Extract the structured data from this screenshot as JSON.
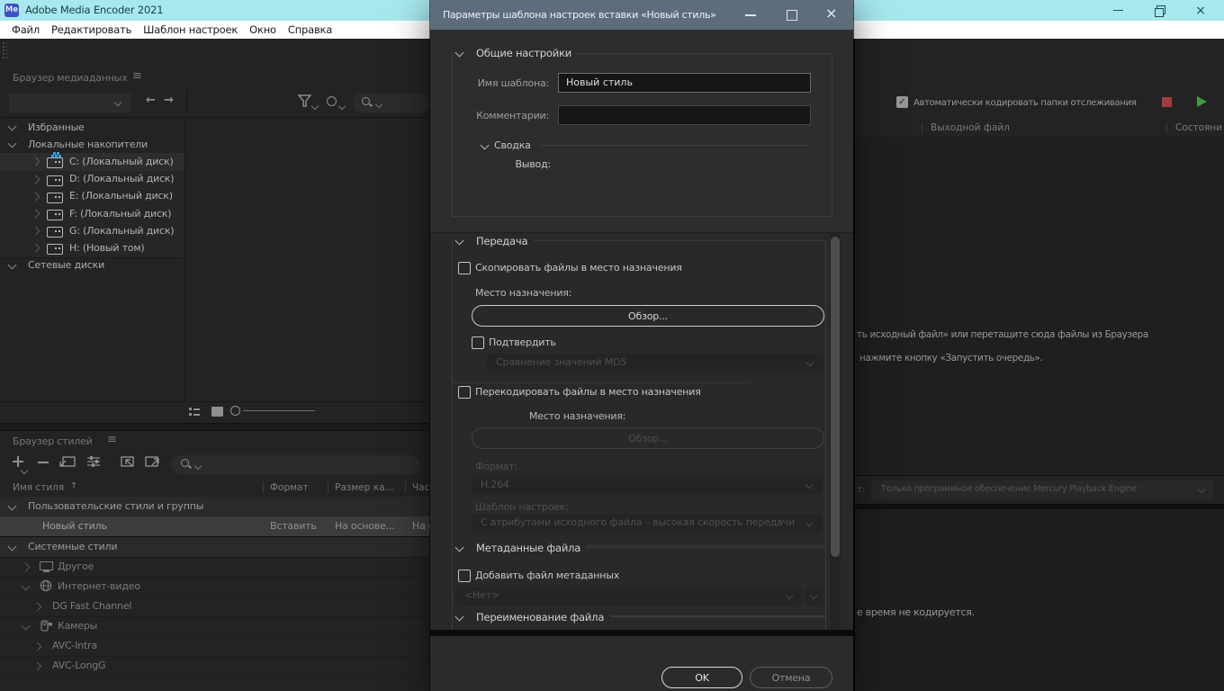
{
  "colors": {
    "titlebar_accent": "#a6e8ee",
    "dialog_titlebar": "#5d6d7c",
    "logo_blue": "#3b52c4",
    "play_green": "#3f9c3f",
    "stop_red": "#a33c3c"
  },
  "titlebar": {
    "logo": "Me",
    "title": "Adobe Media Encoder 2021"
  },
  "menubar": {
    "items": [
      "Файл",
      "Редактировать",
      "Шаблон настроек",
      "Окно",
      "Справка"
    ]
  },
  "media_browser": {
    "title": "Браузер медиаданных",
    "tree": [
      {
        "label": "Избранные"
      },
      {
        "label": "Локальные накопители"
      },
      {
        "label": "C: (Локальный диск)"
      },
      {
        "label": "D: (Локальный диск)"
      },
      {
        "label": "E: (Локальный диск)"
      },
      {
        "label": "F: (Локальный диск)"
      },
      {
        "label": "G: (Локальный диск)"
      },
      {
        "label": "H: (Новый том)"
      },
      {
        "label": "Сетевые диски"
      }
    ]
  },
  "preset_browser": {
    "title": "Браузер стилей",
    "columns": {
      "name": "Имя стиля",
      "format": "Формат",
      "frame_size": "Размер ка...",
      "frame_rate": "Часто"
    },
    "rows": [
      {
        "name": "Пользовательские стили и группы"
      },
      {
        "name": "Новый стиль",
        "format": "Вставить",
        "frame_size": "На основе...",
        "frame_rate": "На ос"
      },
      {
        "name": "Системные стили"
      },
      {
        "name": "Другое"
      },
      {
        "name": "Интернет-видео"
      },
      {
        "name": "DG Fast Channel"
      },
      {
        "name": "Камеры"
      },
      {
        "name": "AVC-Intra"
      },
      {
        "name": "AVC-LongG"
      }
    ]
  },
  "queue": {
    "auto_encode_label": "Автоматически кодировать папки отслеживания",
    "columns": {
      "output_file": "Выходной файл",
      "status": "Состояни"
    },
    "hint_line1": "ть исходный файл» или перетащите сюда файлы из Браузера",
    "hint_line2": "нажмите кнопку «Запустить очередь».",
    "renderer_label_fragment": "т:",
    "renderer_value": "Только программное обеспечение Mercury Playback Engine",
    "status_fragment": "е время не кодируется."
  },
  "dialog": {
    "title": "Параметры шаблона настроек вставки «Новый стиль»",
    "general": {
      "section": "Общие настройки",
      "name_label": "Имя шаблона:",
      "name_value": "Новый стиль",
      "comments_label": "Комментарии:",
      "comments_value": "",
      "summary_section": "Сводка",
      "output_label": "Вывод:"
    },
    "transfer": {
      "section": "Передача",
      "copy_checkbox": "Скопировать файлы в место назначения",
      "destination_label": "Место назначения:",
      "browse_button": "Обзор...",
      "verify_checkbox": "Подтвердить",
      "verify_option": "Сравнение значений MD5",
      "transcode_checkbox": "Перекодировать файлы в место назначения",
      "destination2_label": "Место назначения:",
      "browse2_button": "Обзор...",
      "format_label": "Формат:",
      "format_value": "H.264",
      "preset_label": "Шаблон настроек:",
      "preset_value": "С атрибутами исходного файла – высокая скорость передачи"
    },
    "metadata": {
      "section": "Метаданные файла",
      "add_checkbox": "Добавить файл метаданных",
      "file_value": "<Нет>"
    },
    "rename": {
      "section": "Переименование файла"
    },
    "footer": {
      "ok": "OK",
      "cancel": "Отмена"
    }
  }
}
